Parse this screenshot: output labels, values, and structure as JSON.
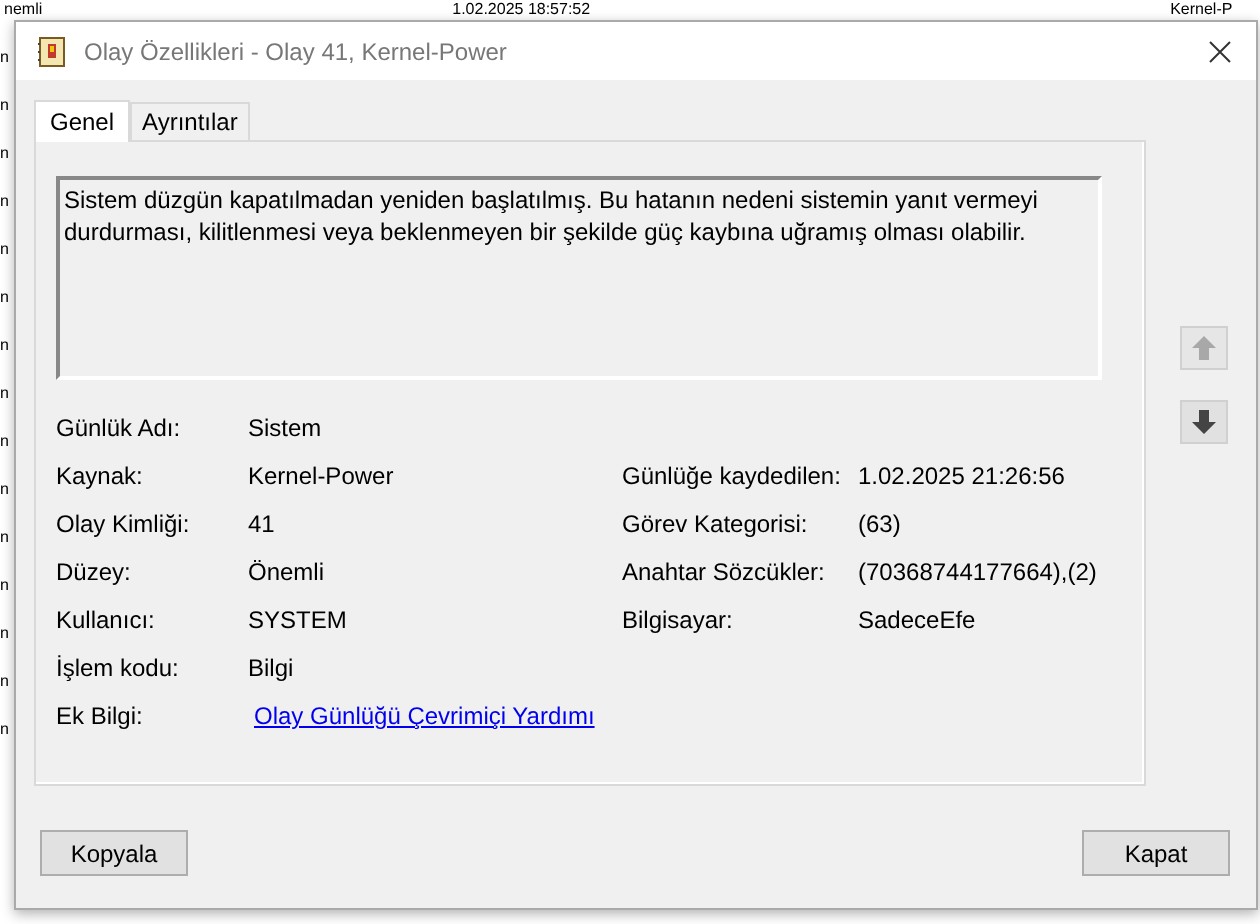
{
  "background_window": {
    "top_row": [
      "nemli",
      "1.02.2025 18:57:52",
      "Kernel-P"
    ],
    "left_column": [
      "n",
      "n",
      "n",
      "n",
      "n",
      "n",
      "n",
      "n",
      "n",
      "n",
      "n",
      "n",
      "n",
      "n",
      "n"
    ]
  },
  "window": {
    "title": "Olay Özellikleri - Olay 41, Kernel-Power"
  },
  "tabs": [
    {
      "label": "Genel",
      "selected": true
    },
    {
      "label": "Ayrıntılar",
      "selected": false
    }
  ],
  "description": "Sistem düzgün kapatılmadan yeniden başlatılmış. Bu hatanın nedeni sistemin yanıt vermeyi durdurması, kilitlenmesi veya beklenmeyen bir şekilde güç kaybına uğramış olması olabilir.",
  "fields_left": [
    {
      "label": "Günlük Adı:",
      "value": "Sistem"
    },
    {
      "label": "Kaynak:",
      "value": "Kernel-Power"
    },
    {
      "label": "Olay Kimliği:",
      "value": "41"
    },
    {
      "label": "Düzey:",
      "value": "Önemli"
    },
    {
      "label": "Kullanıcı:",
      "value": "SYSTEM"
    },
    {
      "label": "İşlem kodu:",
      "value": "Bilgi"
    },
    {
      "label": "Ek Bilgi:",
      "value": "Olay Günlüğü Çevrimiçi Yardımı",
      "kind": "link"
    }
  ],
  "fields_right": [
    {
      "label": "Günlüğe kaydedilen:",
      "value": "1.02.2025 21:26:56"
    },
    {
      "label": "Görev Kategorisi:",
      "value": "(63)"
    },
    {
      "label": "Anahtar Sözcükler:",
      "value": "(70368744177664),(2)"
    },
    {
      "label": "Bilgisayar:",
      "value": "SadeceEfe"
    }
  ],
  "nav_buttons": [
    {
      "kind": "up",
      "disabled": true
    },
    {
      "kind": "down",
      "disabled": false
    }
  ],
  "buttons": [
    "Kopyala",
    "Kapat"
  ]
}
